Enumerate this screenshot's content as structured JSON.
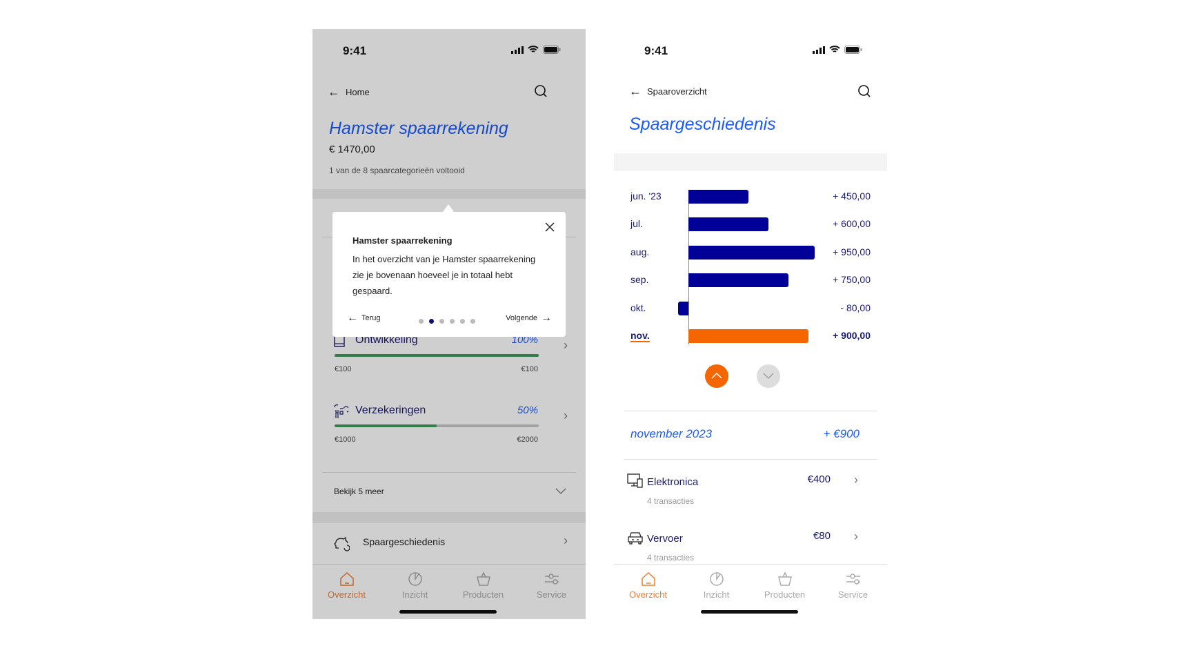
{
  "status_bar": {
    "time": "9:41"
  },
  "left_screen": {
    "nav": {
      "back_label": "Home"
    },
    "title": "Hamster spaarrekening",
    "balance": "€ 1470,00",
    "progress_summary": "1 van de 8 spaarcategorieën voltooid",
    "categories": [
      {
        "name": "Ontwikkeling",
        "percent_label": "100%",
        "progress": 1.0,
        "saved": "€100",
        "goal": "€100"
      },
      {
        "name": "Verzekeringen",
        "percent_label": "50%",
        "progress": 0.5,
        "saved": "€1000",
        "goal": "€2000"
      }
    ],
    "show_more_label": "Bekijk 5 meer",
    "history_link_label": "Spaargeschiedenis",
    "tooltip": {
      "title": "Hamster spaarrekening",
      "body": "In het overzicht van je Hamster spaarrekening zie je bovenaan hoeveel je in totaal hebt gespaard.",
      "back_label": "Terug",
      "next_label": "Volgende",
      "step": 2,
      "steps": 6
    }
  },
  "right_screen": {
    "nav": {
      "back_label": "Spaaroverzicht"
    },
    "title": "Spaargeschiedenis",
    "chart_data": {
      "type": "bar",
      "orientation": "horizontal",
      "categories": [
        "jun. '23",
        "jul.",
        "aug.",
        "sep.",
        "okt.",
        "nov."
      ],
      "values": [
        450,
        600,
        950,
        750,
        -80,
        900
      ],
      "value_labels": [
        "+ 450,00",
        "+ 600,00",
        "+ 950,00",
        "+ 750,00",
        "- 80,00",
        "+ 900,00"
      ],
      "selected": "nov.",
      "colors": {
        "bar": "#000099",
        "selected": "#f56600"
      }
    },
    "selected_month": {
      "label": "november 2023",
      "total": "+ €900"
    },
    "transactions": [
      {
        "icon": "electronics-icon",
        "name": "Elektronica",
        "amount": "€400",
        "count": "4 transacties"
      },
      {
        "icon": "car-icon",
        "name": "Vervoer",
        "amount": "€80",
        "count": "4 transacties"
      }
    ]
  },
  "tabs": [
    {
      "label": "Overzicht",
      "active": true
    },
    {
      "label": "Inzicht",
      "active": false
    },
    {
      "label": "Producten",
      "active": false
    },
    {
      "label": "Service",
      "active": false
    }
  ],
  "colors": {
    "accent": "#f07d2e",
    "primary_blue": "#1a5cff",
    "navy": "#000099",
    "progress_green": "#3f9a5f"
  }
}
